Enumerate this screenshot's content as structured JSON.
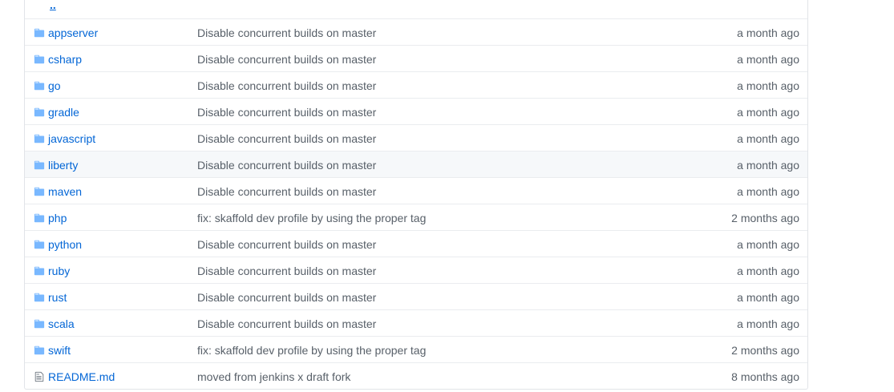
{
  "parent_link": "..",
  "rows": [
    {
      "name": "appserver",
      "type": "folder",
      "message": "Disable concurrent builds on master",
      "age": "a month ago"
    },
    {
      "name": "csharp",
      "type": "folder",
      "message": "Disable concurrent builds on master",
      "age": "a month ago"
    },
    {
      "name": "go",
      "type": "folder",
      "message": "Disable concurrent builds on master",
      "age": "a month ago"
    },
    {
      "name": "gradle",
      "type": "folder",
      "message": "Disable concurrent builds on master",
      "age": "a month ago"
    },
    {
      "name": "javascript",
      "type": "folder",
      "message": "Disable concurrent builds on master",
      "age": "a month ago"
    },
    {
      "name": "liberty",
      "type": "folder",
      "message": "Disable concurrent builds on master",
      "age": "a month ago"
    },
    {
      "name": "maven",
      "type": "folder",
      "message": "Disable concurrent builds on master",
      "age": "a month ago"
    },
    {
      "name": "php",
      "type": "folder",
      "message": "fix: skaffold dev profile by using the proper tag",
      "age": "2 months ago"
    },
    {
      "name": "python",
      "type": "folder",
      "message": "Disable concurrent builds on master",
      "age": "a month ago"
    },
    {
      "name": "ruby",
      "type": "folder",
      "message": "Disable concurrent builds on master",
      "age": "a month ago"
    },
    {
      "name": "rust",
      "type": "folder",
      "message": "Disable concurrent builds on master",
      "age": "a month ago"
    },
    {
      "name": "scala",
      "type": "folder",
      "message": "Disable concurrent builds on master",
      "age": "a month ago"
    },
    {
      "name": "swift",
      "type": "folder",
      "message": "fix: skaffold dev profile by using the proper tag",
      "age": "2 months ago"
    },
    {
      "name": "README.md",
      "type": "file",
      "message": "moved from jenkins x draft fork",
      "age": "8 months ago"
    }
  ],
  "colors": {
    "link": "#0366d6",
    "folder_icon": "#79b8ff",
    "muted_text": "#586069",
    "hover_row": "#f6f8fa"
  }
}
